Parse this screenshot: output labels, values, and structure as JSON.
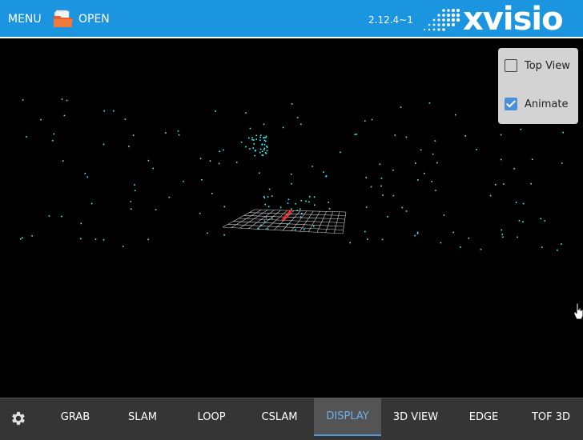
{
  "topbar": {
    "menu_label": "MENU",
    "open_label": "OPEN",
    "version": "2.12.4~1",
    "brand": "xvisio"
  },
  "options": {
    "top_view": {
      "label": "Top View",
      "checked": false
    },
    "animate": {
      "label": "Animate",
      "checked": true
    }
  },
  "tabs": [
    {
      "label": "GRAB",
      "active": false
    },
    {
      "label": "SLAM",
      "active": false
    },
    {
      "label": "LOOP",
      "active": false
    },
    {
      "label": "CSLAM",
      "active": false
    },
    {
      "label": "DISPLAY",
      "active": true
    },
    {
      "label": "3D VIEW",
      "active": false
    },
    {
      "label": "EDGE",
      "active": false
    },
    {
      "label": "TOF 3D",
      "active": false
    }
  ],
  "colors": {
    "topbar": "#1b95e0",
    "bottombar": "#353535",
    "active_tab": "#6db0ea",
    "points": "#33ffff",
    "grid": "#cfcfcf",
    "trajectory": "#ff2a2a"
  },
  "icons": {
    "open": "folder-icon",
    "settings": "gear-icon",
    "cursor": "hand-cursor-icon"
  }
}
